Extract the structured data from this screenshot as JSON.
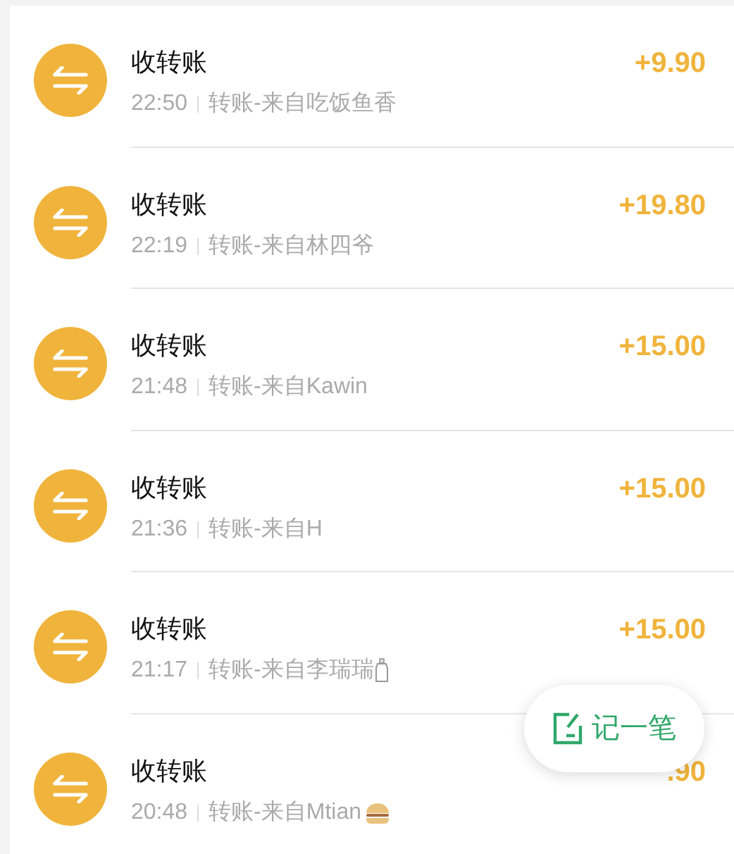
{
  "transactions": [
    {
      "title": "收转账",
      "time": "22:50",
      "note": "转账-来自吃饭鱼香",
      "amount": "+9.90"
    },
    {
      "title": "收转账",
      "time": "22:19",
      "note": "转账-来自林四爷",
      "amount": "+19.80"
    },
    {
      "title": "收转账",
      "time": "21:48",
      "note": "转账-来自Kawin",
      "amount": "+15.00"
    },
    {
      "title": "收转账",
      "time": "21:36",
      "note": "转账-来自H",
      "amount": "+15.00"
    },
    {
      "title": "收转账",
      "time": "21:17",
      "note": "转账-来自李瑞瑞",
      "kind": "bottle",
      "amount": "+15.00"
    },
    {
      "title": "收转账",
      "time": "20:48",
      "note": "转账-来自Mtian",
      "kind": "burger",
      "amount": ".90"
    }
  ],
  "fab": {
    "label": "记一笔"
  }
}
